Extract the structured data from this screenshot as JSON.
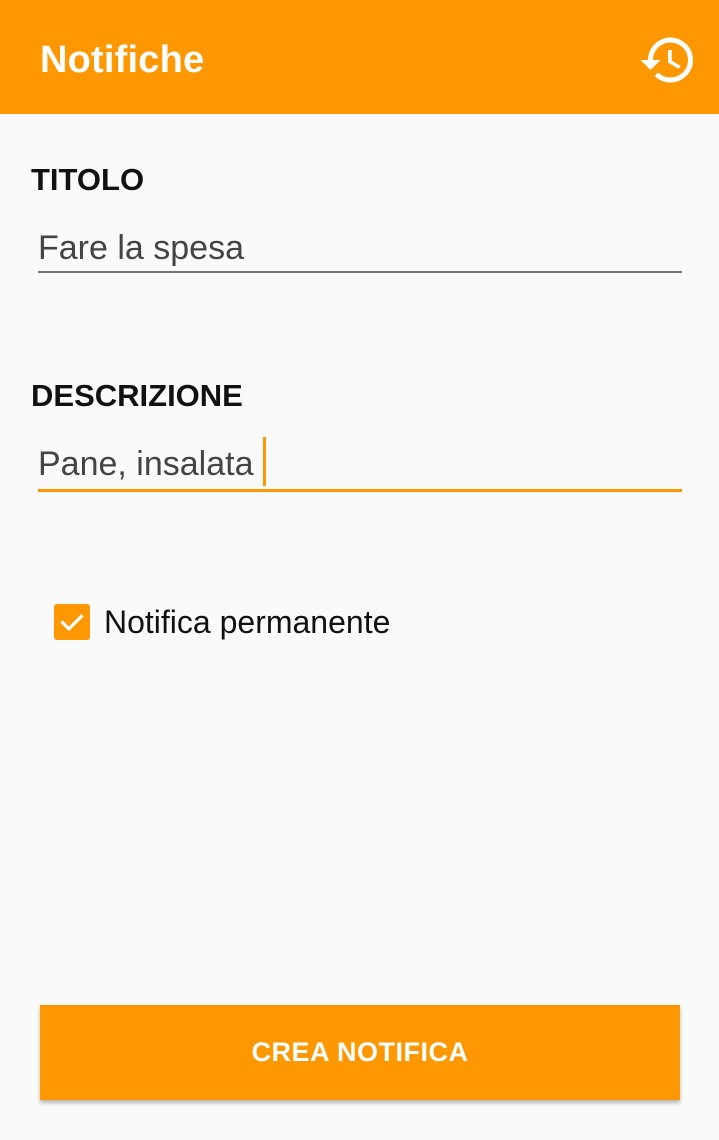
{
  "appbar": {
    "title": "Notifiche",
    "history_icon": "history-icon"
  },
  "form": {
    "title_label": "TITOLO",
    "title_value": "Fare la spesa",
    "description_label": "DESCRIZIONE",
    "description_value": "Pane, insalata",
    "permanent_label": "Notifica permanente",
    "permanent_checked": true
  },
  "actions": {
    "create_label": "CREA NOTIFICA"
  },
  "colors": {
    "accent": "#ff9800",
    "background": "#fafafa",
    "text_primary": "#111111",
    "input_text": "#444444",
    "underline_inactive": "#757575"
  }
}
